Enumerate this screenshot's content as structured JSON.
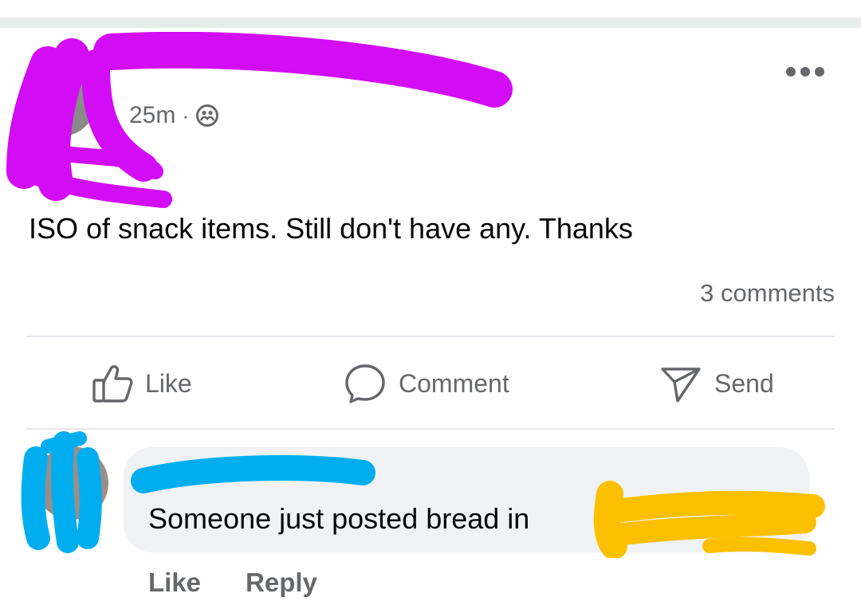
{
  "post": {
    "time": "25m",
    "separator": "·",
    "audience_icon": "friends-icon",
    "more_icon": "more-horizontal-icon",
    "text": "ISO of snack items. Still don't have any. Thanks",
    "comments_count": "3 comments"
  },
  "actions": {
    "like": "Like",
    "comment": "Comment",
    "send": "Send"
  },
  "comment": {
    "text": "Someone just posted bread in",
    "like": "Like",
    "reply": "Reply"
  },
  "colors": {
    "redaction_magenta": "#d20cf4",
    "redaction_blue": "#00aef0",
    "redaction_yellow": "#fcc000",
    "secondary_text": "#65676b",
    "bubble": "#f0f2f5"
  }
}
